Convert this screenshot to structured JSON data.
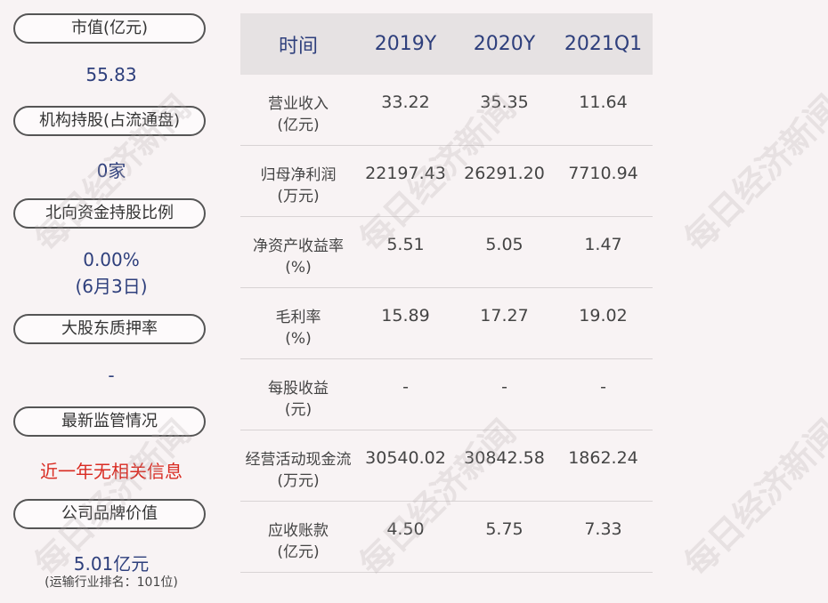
{
  "left": {
    "items": [
      {
        "label": "市值(亿元)",
        "value": "55.83"
      },
      {
        "label": "机构持股(占流通盘)",
        "value": "0家"
      },
      {
        "label": "北向资金持股比例",
        "value": "0.00%",
        "value2": "(6月3日)"
      },
      {
        "label": "大股东质押率",
        "value": "-"
      },
      {
        "label": "最新监管情况",
        "value": "近一年无相关信息"
      },
      {
        "label": "公司品牌价值",
        "value": "5.01亿元",
        "note": "(运输行业排名：101位)"
      }
    ]
  },
  "table": {
    "headers": [
      "时间",
      "2019Y",
      "2020Y",
      "2021Q1"
    ],
    "rows": [
      {
        "label1": "营业收入",
        "label2": "(亿元)",
        "values": [
          "33.22",
          "35.35",
          "11.64"
        ]
      },
      {
        "label1": "归母净利润",
        "label2": "(万元)",
        "values": [
          "22197.43",
          "26291.20",
          "7710.94"
        ]
      },
      {
        "label1": "净资产收益率",
        "label2": "(%)",
        "values": [
          "5.51",
          "5.05",
          "1.47"
        ]
      },
      {
        "label1": "毛利率",
        "label2": "(%)",
        "values": [
          "15.89",
          "17.27",
          "19.02"
        ]
      },
      {
        "label1": "每股收益",
        "label2": "(元)",
        "values": [
          "-",
          "-",
          "-"
        ]
      },
      {
        "label1": "经营活动现金流",
        "label2": "(万元)",
        "values": [
          "30540.02",
          "30842.58",
          "1862.24"
        ]
      },
      {
        "label1": "应收账款",
        "label2": "(亿元)",
        "values": [
          "4.50",
          "5.75",
          "7.33"
        ]
      }
    ]
  },
  "watermark": "每日经济新闻",
  "colors": {
    "accent": "#2e3f7c",
    "alert": "#d92b22",
    "background": "#f8f3f4"
  }
}
